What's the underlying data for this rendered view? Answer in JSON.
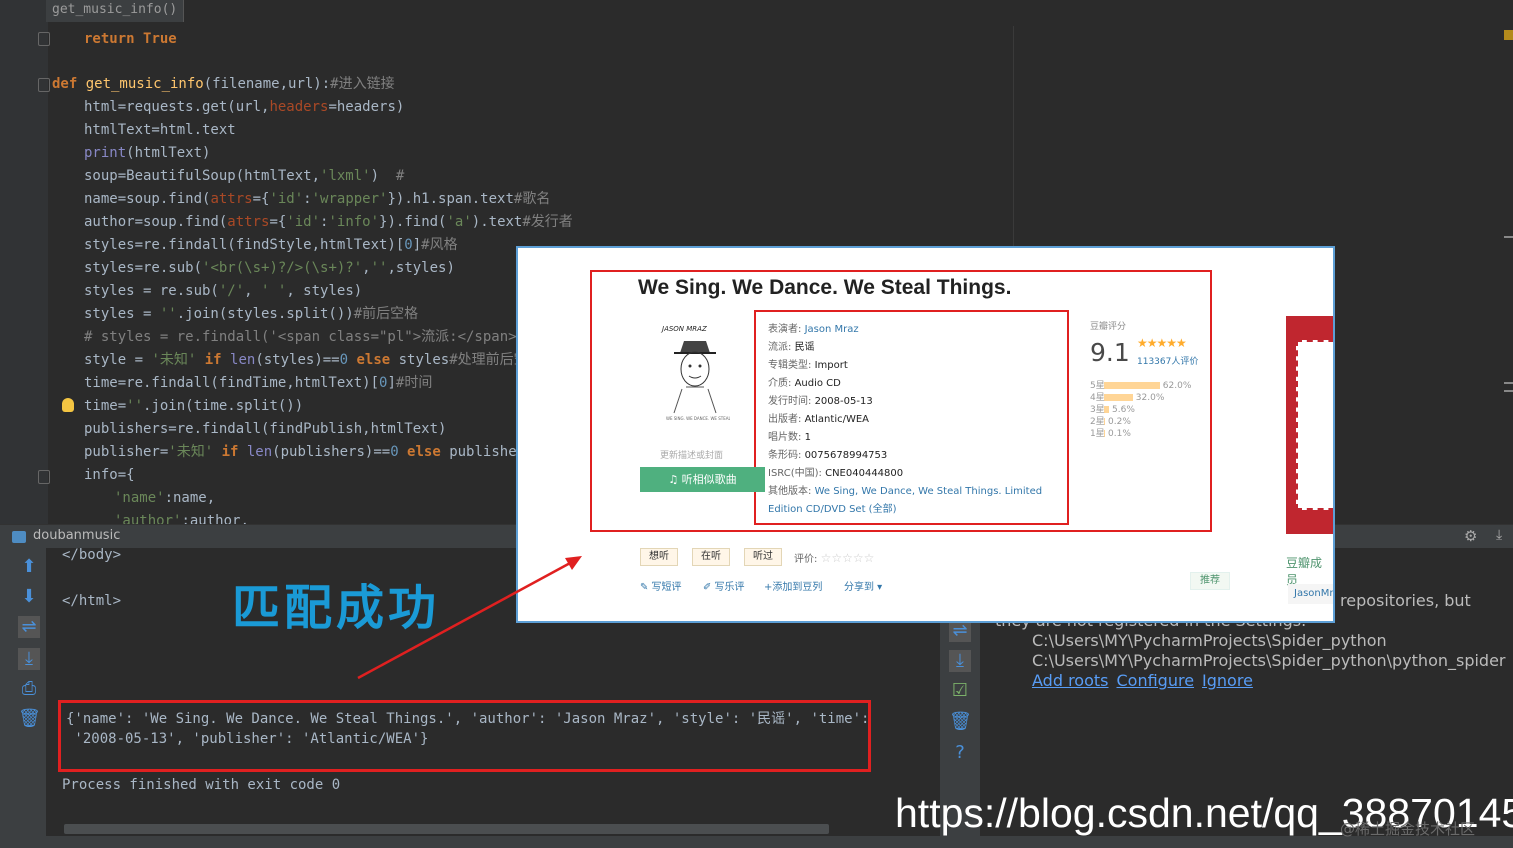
{
  "editor": {
    "breadcrumb": "get_music_info()",
    "lines": [
      {
        "indent": 1,
        "parts": [
          [
            "kw",
            "return "
          ],
          [
            "kw",
            "True"
          ]
        ]
      },
      {
        "indent": 0,
        "parts": []
      },
      {
        "indent": 0,
        "parts": [
          [
            "kw",
            "def "
          ],
          [
            "fn",
            "get_music_info"
          ],
          [
            "",
            "(filename,url):"
          ],
          [
            "cmt",
            "#进入链接"
          ]
        ]
      },
      {
        "indent": 1,
        "parts": [
          [
            "",
            "html=requests.get(url,"
          ],
          [
            "par",
            "headers"
          ],
          [
            "",
            "=headers)"
          ]
        ]
      },
      {
        "indent": 1,
        "parts": [
          [
            "",
            "htmlText=html.text"
          ]
        ]
      },
      {
        "indent": 1,
        "parts": [
          [
            "bi",
            "print"
          ],
          [
            "",
            "(htmlText)"
          ]
        ]
      },
      {
        "indent": 1,
        "parts": [
          [
            "",
            "soup=BeautifulSoup(htmlText,"
          ],
          [
            "str",
            "'lxml'"
          ],
          [
            "",
            ")  "
          ],
          [
            "cmt",
            "#"
          ]
        ]
      },
      {
        "indent": 1,
        "parts": [
          [
            "",
            "name=soup.find("
          ],
          [
            "par",
            "attrs"
          ],
          [
            "",
            "={"
          ],
          [
            "str",
            "'id'"
          ],
          [
            "",
            ":"
          ],
          [
            "str",
            "'wrapper'"
          ],
          [
            "",
            "}).h1.span.text"
          ],
          [
            "cmt",
            "#歌名"
          ]
        ]
      },
      {
        "indent": 1,
        "parts": [
          [
            "",
            "author=soup.find("
          ],
          [
            "par",
            "attrs"
          ],
          [
            "",
            "={"
          ],
          [
            "str",
            "'id'"
          ],
          [
            "",
            ":"
          ],
          [
            "str",
            "'info'"
          ],
          [
            "",
            "}).find("
          ],
          [
            "str",
            "'a'"
          ],
          [
            "",
            ").text"
          ],
          [
            "cmt",
            "#发行者"
          ]
        ]
      },
      {
        "indent": 1,
        "parts": [
          [
            "",
            "styles=re.findall(findStyle,htmlText)["
          ],
          [
            "num",
            "0"
          ],
          [
            "",
            "]"
          ],
          [
            "cmt",
            "#风格"
          ]
        ]
      },
      {
        "indent": 1,
        "parts": [
          [
            "",
            "styles=re.sub("
          ],
          [
            "str",
            "'<br(\\s+)?/>(\\s+)?'"
          ],
          [
            "",
            ","
          ],
          [
            "str",
            "''"
          ],
          [
            "",
            ",styles)"
          ]
        ]
      },
      {
        "indent": 1,
        "parts": [
          [
            "",
            "styles = re.sub("
          ],
          [
            "str",
            "'/'"
          ],
          [
            "",
            ", "
          ],
          [
            "str",
            "' '"
          ],
          [
            "",
            ", styles)"
          ]
        ]
      },
      {
        "indent": 1,
        "parts": [
          [
            "",
            "styles = "
          ],
          [
            "str",
            "''"
          ],
          [
            "",
            ".join(styles.split())"
          ],
          [
            "cmt",
            "#前后空格"
          ]
        ]
      },
      {
        "indent": 1,
        "parts": [
          [
            "cmt",
            "# styles = re.findall('<span class=\"pl\">流派:</span>&nb"
          ]
        ]
      },
      {
        "indent": 1,
        "parts": [
          [
            "",
            "style = "
          ],
          [
            "str",
            "'未知'"
          ],
          [
            "kw",
            " if "
          ],
          [
            "bi",
            "len"
          ],
          [
            "",
            "(styles)=="
          ],
          [
            "num",
            "0"
          ],
          [
            "kw",
            " else "
          ],
          [
            "",
            "styles"
          ],
          [
            "cmt",
            "#处理前后空"
          ]
        ]
      },
      {
        "indent": 1,
        "parts": [
          [
            "",
            "time=re.findall(findTime,htmlText)["
          ],
          [
            "num",
            "0"
          ],
          [
            "",
            "]"
          ],
          [
            "cmt",
            "#时间"
          ]
        ]
      },
      {
        "indent": 1,
        "parts": [
          [
            "",
            "time="
          ],
          [
            "str",
            "''"
          ],
          [
            "",
            ".join(time.split())"
          ]
        ]
      },
      {
        "indent": 1,
        "parts": [
          [
            "",
            "publishers=re.findall(findPublish,htmlText)"
          ]
        ]
      },
      {
        "indent": 1,
        "parts": [
          [
            "",
            "publisher="
          ],
          [
            "str",
            "'未知'"
          ],
          [
            "kw",
            " if "
          ],
          [
            "bi",
            "len"
          ],
          [
            "",
            "(publishers)=="
          ],
          [
            "num",
            "0"
          ],
          [
            "kw",
            " else "
          ],
          [
            "",
            "publishers"
          ]
        ]
      },
      {
        "indent": 1,
        "parts": [
          [
            "",
            "info={"
          ]
        ]
      },
      {
        "indent": 2,
        "parts": [
          [
            "str",
            "'name'"
          ],
          [
            "",
            ":name,"
          ]
        ]
      },
      {
        "indent": 2,
        "parts": [
          [
            "str",
            "'author'"
          ],
          [
            "",
            ":author,"
          ]
        ]
      }
    ]
  },
  "run_panel": {
    "tab_title": "doubanmusic",
    "lines_top": [
      "</body>",
      "",
      "</html>"
    ],
    "result_line1": "{'name': 'We Sing. We Dance. We Steal Things.', 'author': 'Jason Mraz', 'style': '民谣', 'time':",
    "result_line2": " '2008-05-13', 'publisher': 'Atlantic/WEA'}",
    "exit_line": "Process finished with exit code 0"
  },
  "annotation": {
    "matched_text": "匹配成功"
  },
  "event_log": {
    "line1": "repositories, but",
    "line2": "they are not registered in the Settings.",
    "path1": "C:\\Users\\MY\\PycharmProjects\\Spider_python",
    "path2": "C:\\Users\\MY\\PycharmProjects\\Spider_python\\python_spider",
    "links": [
      "Add roots",
      "Configure",
      "Ignore"
    ]
  },
  "douban": {
    "title": "We Sing. We Dance. We Steal Things.",
    "cover_text": "更新描述或封面",
    "listen_button": "♫ 听相似歌曲",
    "info": [
      {
        "k": "表演者: ",
        "v": "Jason Mraz",
        "link": true
      },
      {
        "k": "流派: ",
        "v": "民谣"
      },
      {
        "k": "专辑类型: ",
        "v": "Import"
      },
      {
        "k": "介质: ",
        "v": "Audio CD"
      },
      {
        "k": "发行时间: ",
        "v": "2008-05-13"
      },
      {
        "k": "出版者: ",
        "v": "Atlantic/WEA"
      },
      {
        "k": "唱片数: ",
        "v": "1"
      },
      {
        "k": "条形码: ",
        "v": "0075678994753"
      },
      {
        "k": "ISRC(中国): ",
        "v": "CNE040444800"
      },
      {
        "k": "其他版本: ",
        "v": " We Sing, We Dance, We Steal Things. Limited",
        "link": true
      },
      {
        "k": "",
        "v": "Edition CD/DVD Set  (全部)",
        "link": true
      }
    ],
    "rating_label": "豆瓣评分",
    "rating_score": "9.1",
    "rating_stars": "★★★★★",
    "rating_count": "113367人评价",
    "distribution": [
      {
        "label": "5星",
        "pct": "62.0%",
        "value": 62.0
      },
      {
        "label": "4星",
        "pct": "32.0%",
        "value": 32.0
      },
      {
        "label": "3星",
        "pct": "5.6%",
        "value": 5.6
      },
      {
        "label": "2星",
        "pct": "0.2%",
        "value": 0.2
      },
      {
        "label": "1星",
        "pct": "0.1%",
        "value": 0.1
      }
    ],
    "buttons": [
      "想听",
      "在听",
      "听过"
    ],
    "rate_label": "评价: ",
    "rate_stars": "☆☆☆☆☆",
    "actions": [
      "✎ 写短评",
      "✐ 写乐评",
      "+添加到豆列",
      "分享到 ▾"
    ],
    "recommend": "推荐",
    "side_title": "豆瓣成员",
    "side_item": "JasonMr"
  },
  "watermark": {
    "url": "https://blog.csdn.net/qq_38870145",
    "community": "@稀土掘金技术社区"
  }
}
